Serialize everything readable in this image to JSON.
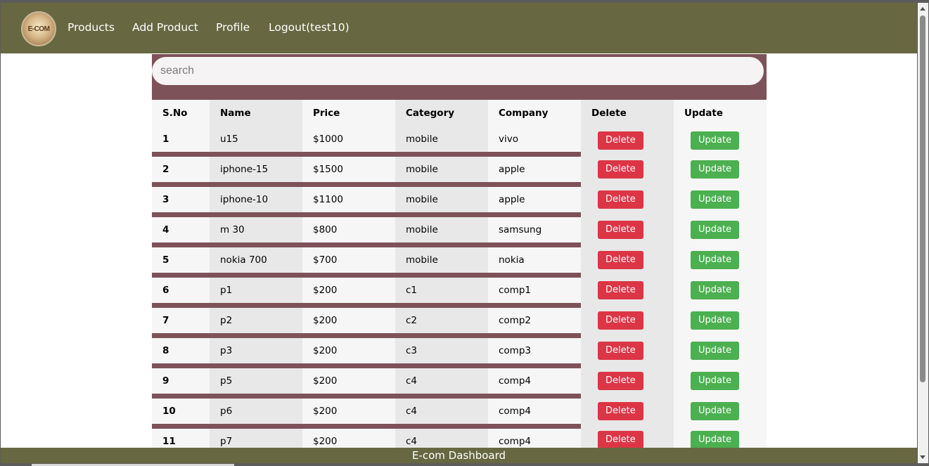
{
  "nav": {
    "logo_text": "E-COM",
    "links": [
      "Products",
      "Add Product",
      "Profile",
      "Logout(test10)"
    ]
  },
  "search": {
    "placeholder": "search",
    "value": ""
  },
  "table": {
    "headers": [
      "S.No",
      "Name",
      "Price",
      "Category",
      "Company",
      "Delete",
      "Update"
    ],
    "rows": [
      {
        "sno": "1",
        "name": "u15",
        "price": "$1000",
        "category": "mobile",
        "company": "vivo"
      },
      {
        "sno": "2",
        "name": "iphone-15",
        "price": "$1500",
        "category": "mobile",
        "company": "apple"
      },
      {
        "sno": "3",
        "name": "iphone-10",
        "price": "$1100",
        "category": "mobile",
        "company": "apple"
      },
      {
        "sno": "4",
        "name": "m 30",
        "price": "$800",
        "category": "mobile",
        "company": "samsung"
      },
      {
        "sno": "5",
        "name": "nokia 700",
        "price": "$700",
        "category": "mobile",
        "company": "nokia"
      },
      {
        "sno": "6",
        "name": "p1",
        "price": "$200",
        "category": "c1",
        "company": "comp1"
      },
      {
        "sno": "7",
        "name": "p2",
        "price": "$200",
        "category": "c2",
        "company": "comp2"
      },
      {
        "sno": "8",
        "name": "p3",
        "price": "$200",
        "category": "c3",
        "company": "comp3"
      },
      {
        "sno": "9",
        "name": "p5",
        "price": "$200",
        "category": "c4",
        "company": "comp4"
      },
      {
        "sno": "10",
        "name": "p6",
        "price": "$200",
        "category": "c4",
        "company": "comp4"
      },
      {
        "sno": "11",
        "name": "p7",
        "price": "$200",
        "category": "c4",
        "company": "comp4"
      }
    ],
    "delete_label": "Delete",
    "update_label": "Update"
  },
  "footer": {
    "text": "E-com Dashboard"
  },
  "colors": {
    "nav_bg": "#676841",
    "accent": "#7d5259",
    "delete": "#dc3545",
    "update": "#4caf50"
  }
}
